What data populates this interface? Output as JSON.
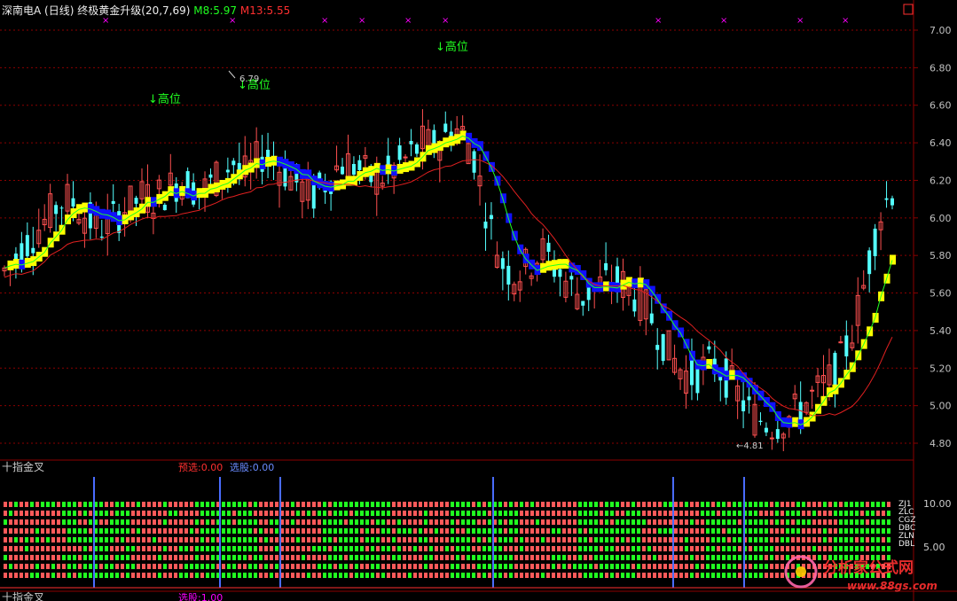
{
  "header": {
    "stock": "深南电A",
    "period": "(日线)",
    "indicator": "终极黄金升级",
    "params": "(20,7,69)",
    "m8": "M8:5.97",
    "m13": "M13:5.55"
  },
  "lower_panel": {
    "title": "十指金叉",
    "pre_label": "预选:0.00",
    "select_label": "选股:0.00",
    "bottom_title": "十指金叉",
    "bottom_select": "选股:1.00",
    "right_labels": [
      "ZJ1",
      "ZLC",
      "CGZ",
      "DBC",
      "ZLN",
      "DBL"
    ],
    "right_ticks": [
      "10.00",
      "5.00"
    ]
  },
  "price_axis": [
    "7.00",
    "6.80",
    "6.60",
    "6.40",
    "6.20",
    "6.00",
    "5.80",
    "5.60",
    "5.40",
    "5.20",
    "5.00",
    "4.80"
  ],
  "annotations": {
    "high1": "↓高位",
    "high2": "↓高位",
    "high3": "↓高位",
    "max_label": "6.79",
    "min_label": "←4.81"
  },
  "watermark": {
    "name": "分析家公式网",
    "url": "www.88gs.com"
  },
  "colors": {
    "up": "#ff5050",
    "down": "#54ffff",
    "ma_red": "#e02020",
    "ma_green": "#20ff20",
    "band_up": "#ffff00",
    "band_down": "#1010ff",
    "grid": "#8b0000",
    "axis_text": "#c0c0c0",
    "magenta": "#ff00ff",
    "blue_line": "#4a6cff"
  },
  "chart_data": {
    "type": "candlestick",
    "y_axis": {
      "min": 4.75,
      "max": 7.05,
      "ticks": [
        7.0,
        6.8,
        6.6,
        6.4,
        6.2,
        6.0,
        5.8,
        5.6,
        5.4,
        5.2,
        5.0,
        4.8
      ]
    },
    "highest": 6.79,
    "lowest": 4.81,
    "close_trend": [
      5.72,
      5.78,
      5.85,
      5.92,
      5.98,
      6.05,
      6.1,
      6.08,
      6.02,
      5.96,
      5.95,
      6.0,
      6.05,
      6.08,
      6.12,
      6.1,
      6.14,
      6.18,
      6.2,
      6.16,
      6.15,
      6.2,
      6.25,
      6.3,
      6.22,
      6.28,
      6.35,
      6.3,
      6.25,
      6.2,
      6.15,
      6.12,
      6.18,
      6.25,
      6.3,
      6.28,
      6.24,
      6.2,
      6.22,
      6.26,
      6.3,
      6.35,
      6.4,
      6.38,
      6.42,
      6.48,
      6.45,
      6.35,
      6.1,
      5.9,
      5.75,
      5.7,
      5.72,
      5.78,
      5.82,
      5.75,
      5.68,
      5.62,
      5.58,
      5.62,
      5.65,
      5.67,
      5.65,
      5.6,
      5.55,
      5.45,
      5.35,
      5.25,
      5.18,
      5.15,
      5.2,
      5.22,
      5.18,
      5.1,
      5.02,
      4.95,
      4.92,
      4.9,
      4.92,
      4.95,
      5.0,
      5.05,
      5.1,
      5.15,
      5.25,
      5.4,
      5.6,
      5.85,
      6.05,
      6.15
    ]
  }
}
